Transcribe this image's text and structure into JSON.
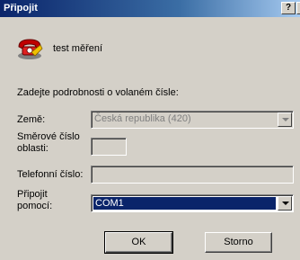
{
  "window": {
    "title": "Připojit",
    "help_button": "?",
    "close_button": "×"
  },
  "connection": {
    "name": "test měření",
    "icon": "phone-icon"
  },
  "prompt": "Zadejte podrobnosti o volaném čísle:",
  "fields": {
    "country_label": "Země:",
    "country_value": "Česká republika (420)",
    "area_label_line1": "Směrové číslo",
    "area_label_line2": "oblasti:",
    "area_value": "",
    "phone_label": "Telefonní číslo:",
    "phone_value": "",
    "connect_label_line1": "Připojit",
    "connect_label_line2": "pomocí:",
    "connect_value": "COM1"
  },
  "buttons": {
    "ok": "OK",
    "cancel": "Storno"
  }
}
